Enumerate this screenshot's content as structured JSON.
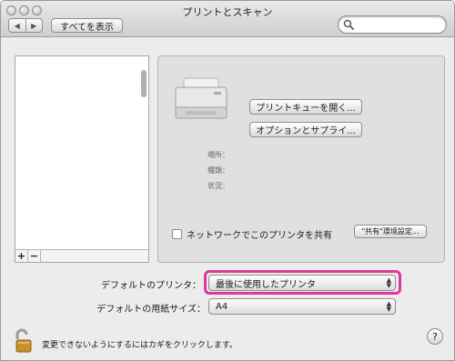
{
  "window": {
    "title": "プリントとスキャン"
  },
  "toolbar": {
    "back_glyph": "◀",
    "forward_glyph": "▶",
    "show_all_label": "すべてを表示",
    "search_placeholder": ""
  },
  "printer_list": {
    "add_label": "+",
    "remove_label": "−"
  },
  "detail": {
    "open_queue_label": "プリントキューを開く...",
    "options_label": "オプションとサプライ...",
    "location_label": "場所：",
    "kind_label": "種類：",
    "status_label": "状況：",
    "share_label": "ネットワークでこのプリンタを共有",
    "share_checked": false,
    "share_prefs_label": "\"共有\"環境設定..."
  },
  "defaults": {
    "default_printer_label": "デフォルトのプリンタ：",
    "default_printer_value": "最後に使用したプリンタ",
    "paper_size_label": "デフォルトの用紙サイズ：",
    "paper_size_value": "A4"
  },
  "footer": {
    "lock_text": "変更できないようにするにはカギをクリックします。",
    "help_label": "?"
  },
  "colors": {
    "highlight": "#e0379a",
    "lock_gold": "#c8902f"
  }
}
